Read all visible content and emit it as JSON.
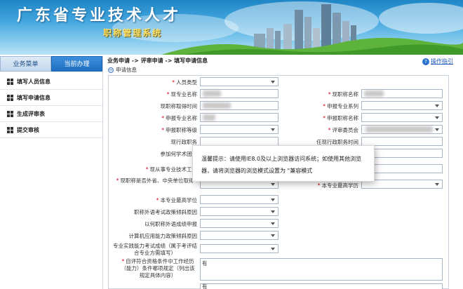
{
  "banner": {
    "title": "广东省专业技术人才",
    "subtitle": "职称管理系统"
  },
  "sidebar": {
    "tabs": [
      {
        "label": "业务菜单",
        "active": false
      },
      {
        "label": "当前办理",
        "active": true
      }
    ],
    "items": [
      {
        "label": "填写人员信息"
      },
      {
        "label": "填写申请信息"
      },
      {
        "label": "生成评审表"
      },
      {
        "label": "提交审核"
      }
    ]
  },
  "header": {
    "breadcrumb": "业务申请 -> 评审申请 -> 填写申请信息",
    "help_label": "操作指引",
    "help_icon": "question-icon"
  },
  "section": {
    "toggle": "−",
    "title": "申请信息"
  },
  "form": {
    "person_type_label": "人员类型",
    "current_major_label": "现专业名称",
    "current_title_label": "现职称名称",
    "title_obtained_time_label": "现职称取得时间",
    "apply_series_label": "申报专业系列",
    "apply_major_label": "申报专业名称",
    "apply_title_name_label": "申报职称名称",
    "apply_title_level_label": "申报职称等级",
    "review_committee_label": "评审委员会",
    "current_admin_post_label": "现行政职务",
    "admin_post_time_label": "任现行政职务时间",
    "academic_group_label": "参加何学术团体",
    "current_work_label": "现从事专业技术工作",
    "outside_title_label": "现职称是否外省、中央单位取得",
    "highest_edu_label": "本专业最高学历",
    "highest_degree_label": "本专业最高学位",
    "lang_exempt_label": "职称外语考试政策倾斜原因",
    "lang_grade_label": "以何职称外语成绩申报",
    "computer_exempt_label": "计算机应用能力政策倾斜原因",
    "practice_exam_label": "专业实践能力考试成绩（属于考评结合专业方需填写）",
    "self_check_label": "自评符合资格条件中工作经历（能力）条件哪项规定（列出该规定具体内容）",
    "self_check_value": "有",
    "extra_value": "有"
  },
  "modal": {
    "message": "温馨提示：请使用IE8.0及以上浏览器访问系统；如使用其他浏览器，请将浏览器的浏览模式设置为 \"兼容模式"
  },
  "colors": {
    "accent": "#1f6fc2",
    "required": "#d0021b",
    "banner_title": "#ffffff",
    "banner_subtitle": "#ffe36a"
  }
}
